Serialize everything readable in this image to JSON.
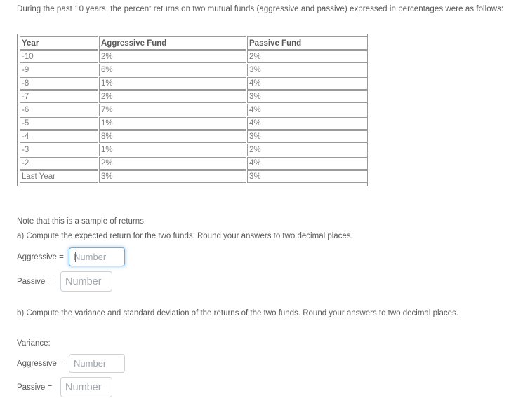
{
  "intro": "During the past 10 years, the percent returns on two mutual funds (aggressive and passive) expressed in percentages were as follows:",
  "table": {
    "columns": [
      "Year",
      "Aggressive Fund",
      "Passive Fund"
    ],
    "rows": [
      [
        "-10",
        "2%",
        "2%"
      ],
      [
        "-9",
        "6%",
        "3%"
      ],
      [
        "-8",
        "1%",
        "4%"
      ],
      [
        "-7",
        "2%",
        "3%"
      ],
      [
        "-6",
        "7%",
        "4%"
      ],
      [
        "-5",
        "1%",
        "4%"
      ],
      [
        "-4",
        "8%",
        "3%"
      ],
      [
        "-3",
        "1%",
        "2%"
      ],
      [
        "-2",
        "2%",
        "4%"
      ],
      [
        "Last Year",
        "3%",
        "3%"
      ]
    ]
  },
  "note": "Note that this is a sample of returns.",
  "part_a": {
    "prompt": "a) Compute the expected return for the two funds.  Round your answers to two decimal places.",
    "aggressive_label": "Aggressive =",
    "aggressive_value": "",
    "aggressive_placeholder": "Number",
    "passive_label": "Passive =",
    "passive_value": "",
    "passive_placeholder": "Number"
  },
  "part_b": {
    "prompt": "b) Compute the variance and standard deviation of the returns of the two funds.  Round your answers to two decimal places.",
    "variance_label": "Variance:",
    "aggressive_label": "Aggressive =",
    "aggressive_value": "",
    "aggressive_placeholder": "Number",
    "passive_label": "Passive =",
    "passive_value": "",
    "passive_placeholder": "Number"
  },
  "colors": {
    "text": "#58595b",
    "table_text": "#7c7c7c",
    "border": "#9a9a9a",
    "focus_ring": "#66afe9",
    "placeholder": "#a2a6aa"
  }
}
